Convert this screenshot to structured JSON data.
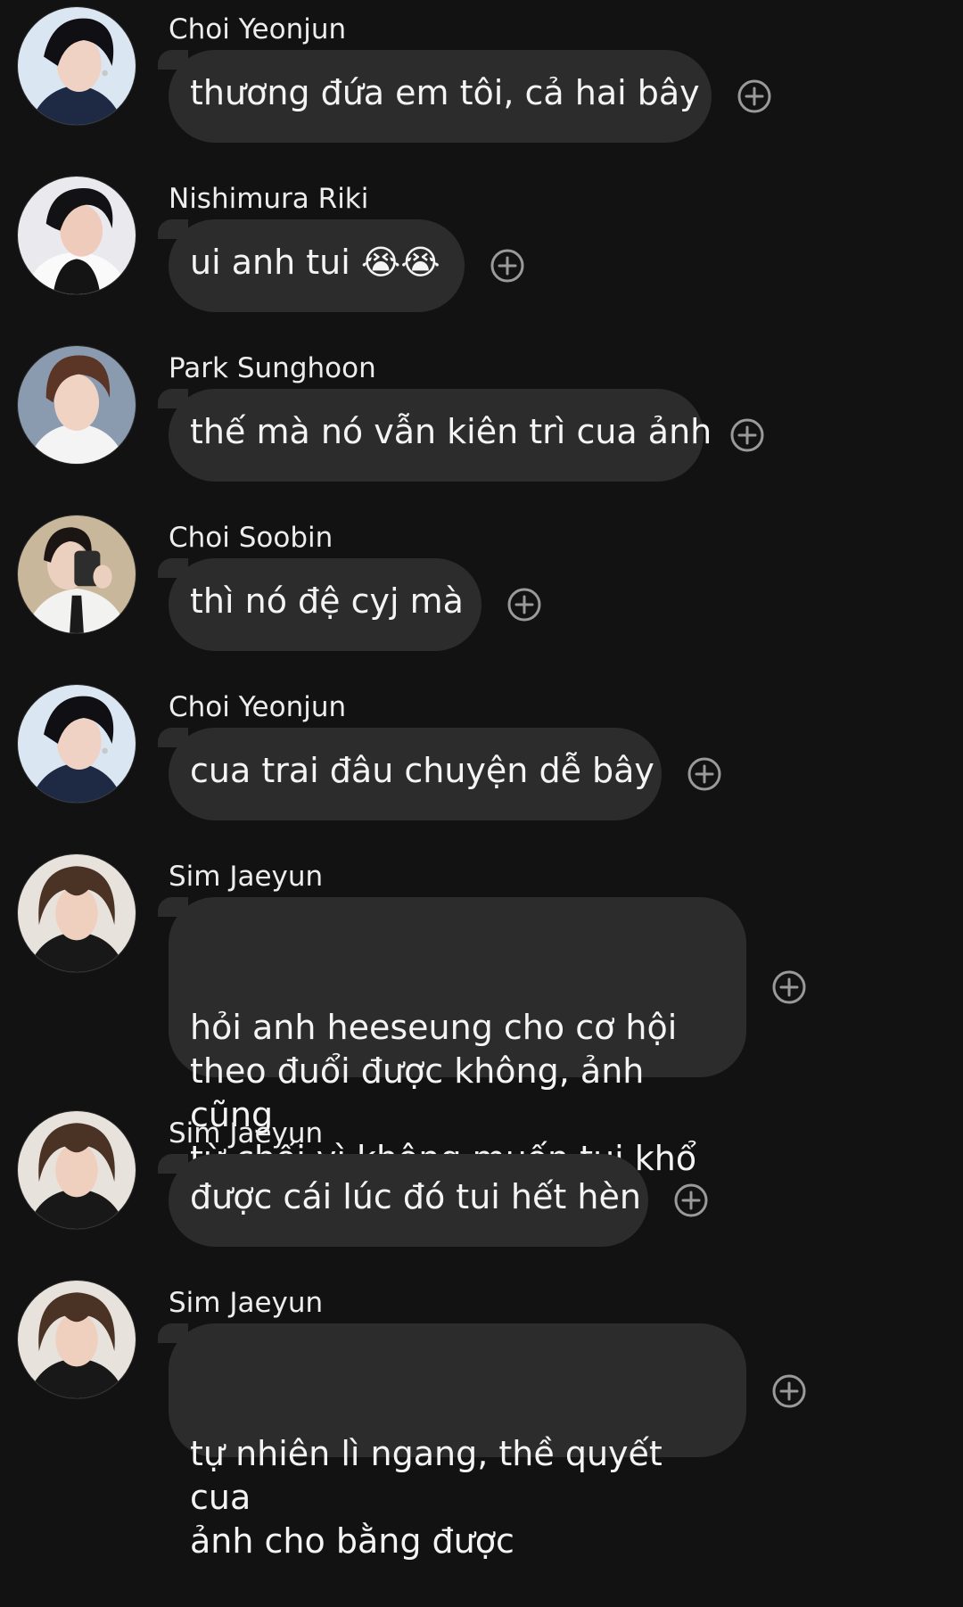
{
  "messages": [
    {
      "sender": "Choi Yeonjun",
      "text": "thương đứa em tôi, cả hai bây",
      "avatar_icon": "avatar-choi-yeonjun",
      "react_icon": "add-reaction-icon"
    },
    {
      "sender": "Nishimura Riki",
      "text": "ui anh tui 😭😭",
      "avatar_icon": "avatar-nishimura-riki",
      "react_icon": "add-reaction-icon"
    },
    {
      "sender": "Park Sunghoon",
      "text": "thế mà nó vẫn kiên trì cua ảnh",
      "avatar_icon": "avatar-park-sunghoon",
      "react_icon": "add-reaction-icon"
    },
    {
      "sender": "Choi Soobin",
      "text": "thì nó đệ cyj mà",
      "avatar_icon": "avatar-choi-soobin",
      "react_icon": "add-reaction-icon"
    },
    {
      "sender": "Choi Yeonjun",
      "text": "cua trai đâu chuyện dễ bây",
      "avatar_icon": "avatar-choi-yeonjun",
      "react_icon": "add-reaction-icon"
    },
    {
      "sender": "Sim Jaeyun",
      "text": "hỏi anh heeseung cho cơ hội\ntheo đuổi được không, ảnh cũng\ntừ chối vì không muốn tui khổ",
      "avatar_icon": "avatar-sim-jaeyun",
      "react_icon": "add-reaction-icon"
    },
    {
      "sender": "Sim Jaeyun",
      "text": "được cái lúc đó tui hết hèn",
      "avatar_icon": "avatar-sim-jaeyun",
      "react_icon": "add-reaction-icon"
    },
    {
      "sender": "Sim Jaeyun",
      "text": "tự nhiên lì ngang, thề quyết cua\nảnh cho bằng được",
      "avatar_icon": "avatar-sim-jaeyun",
      "react_icon": "add-reaction-icon"
    }
  ],
  "colors": {
    "background": "#121212",
    "bubble": "#2c2c2c",
    "text": "#f4f4f4",
    "sender": "#ededed",
    "react_icon": "#9a9a9a"
  }
}
